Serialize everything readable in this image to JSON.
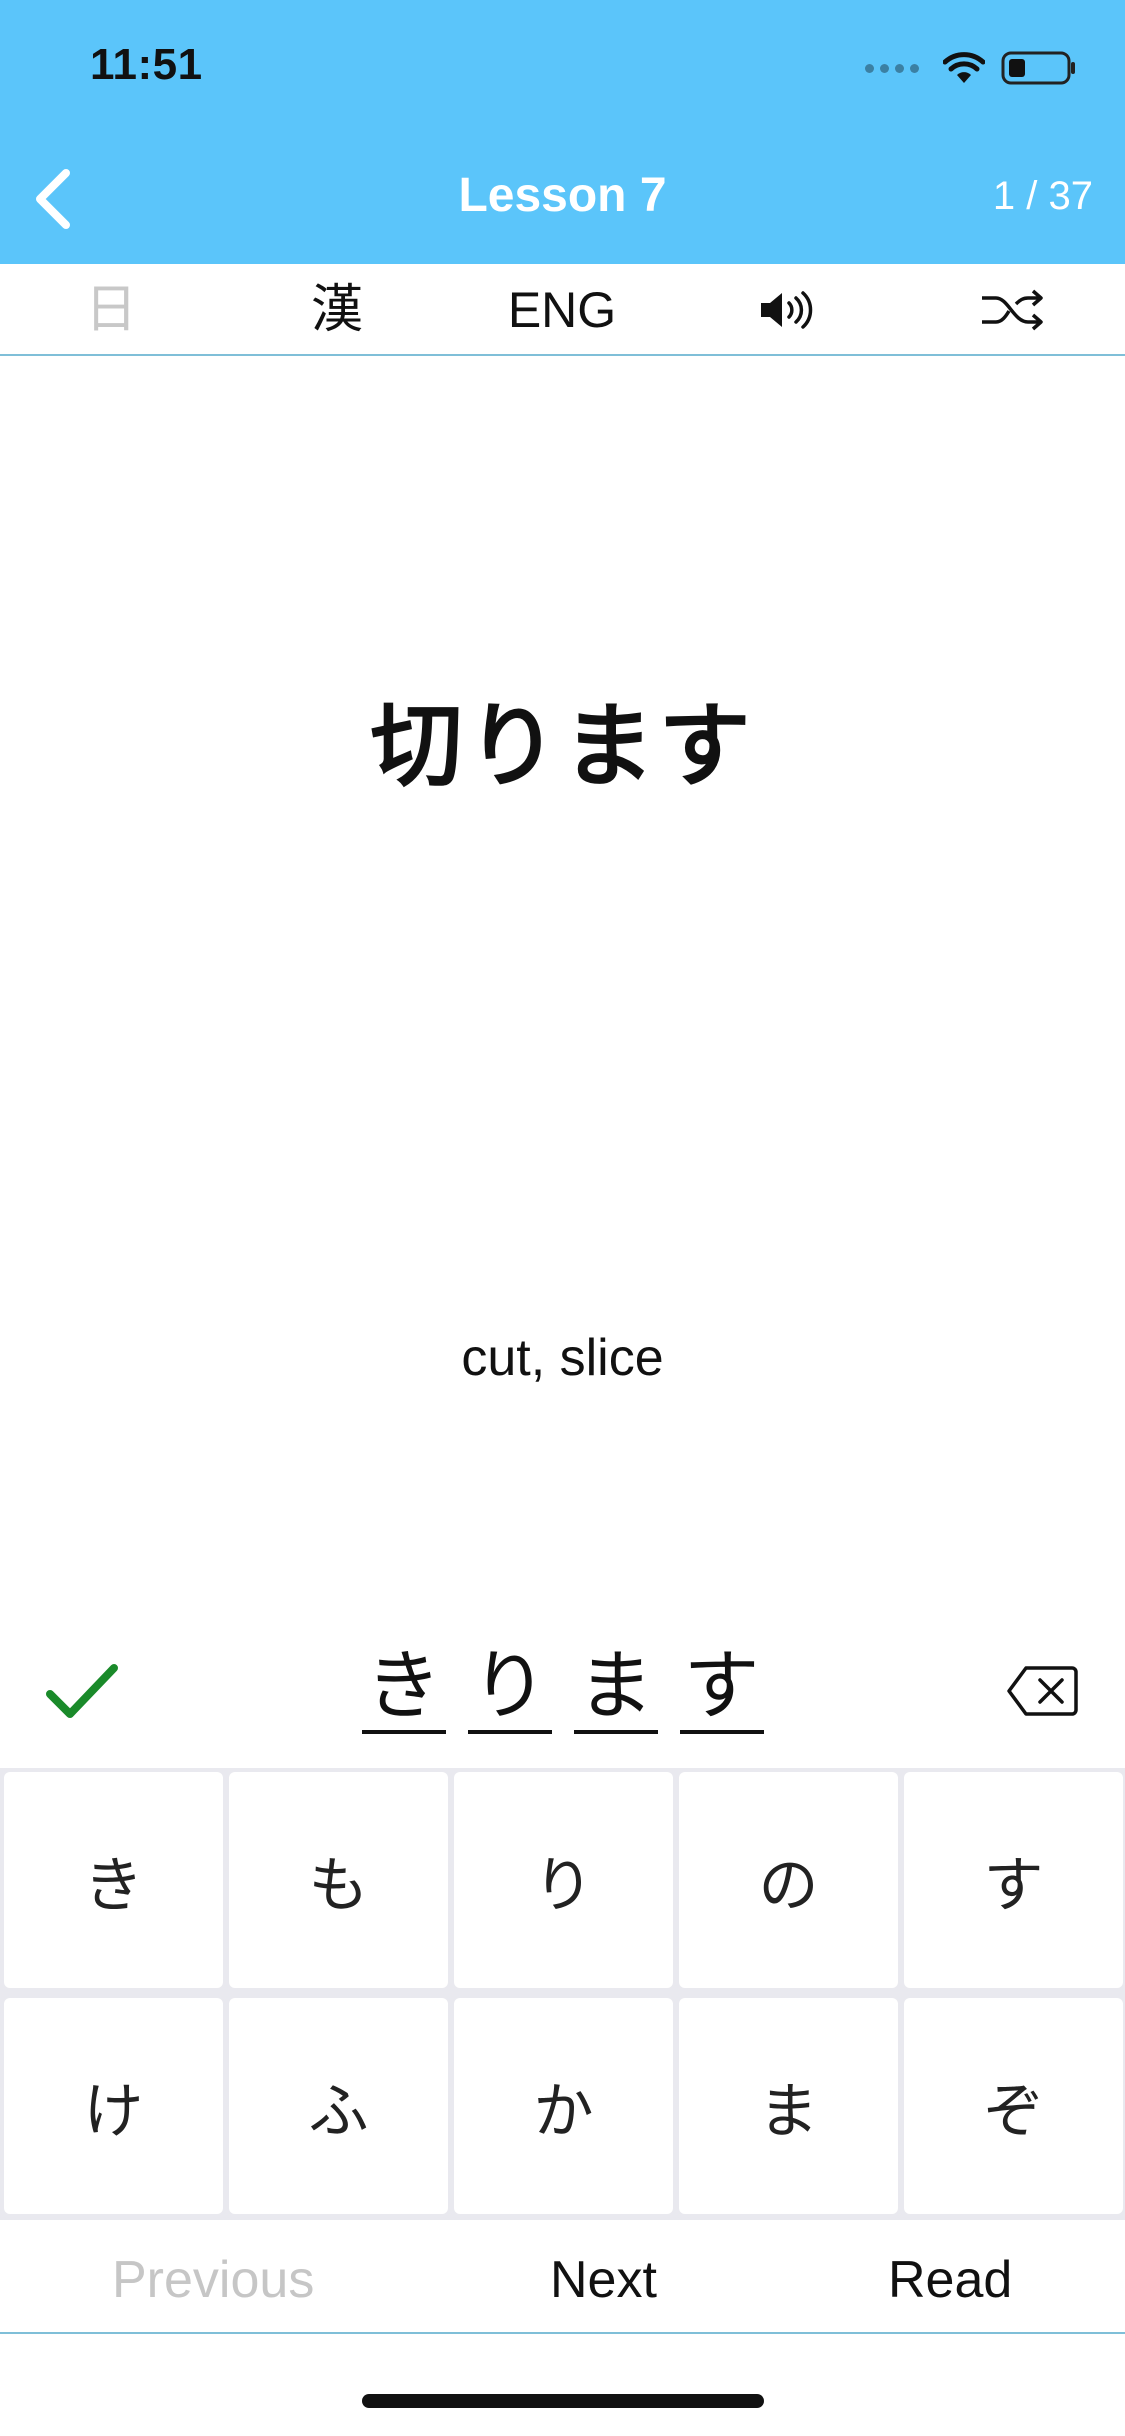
{
  "status_bar": {
    "time": "11:51",
    "icons": [
      "signal-dots-icon",
      "wifi-icon",
      "battery-icon"
    ]
  },
  "nav": {
    "title": "Lesson 7",
    "progress": "1 / 37",
    "back_icon": "chevron-left-icon"
  },
  "toolbar": {
    "day_label": "日",
    "kanji_label": "漢",
    "eng_label": "ENG",
    "sound_icon": "speaker-icon",
    "shuffle_icon": "shuffle-icon"
  },
  "card": {
    "word": "切ります",
    "meaning": "cut, slice"
  },
  "answer": {
    "chars": [
      "き",
      "り",
      "ま",
      "す"
    ],
    "status_icon": "checkmark-icon",
    "backspace_icon": "backspace-icon"
  },
  "keyboard": {
    "rows": [
      [
        "き",
        "も",
        "り",
        "の",
        "す"
      ],
      [
        "け",
        "ふ",
        "か",
        "ま",
        "ぞ"
      ]
    ]
  },
  "bottom_nav": {
    "previous": "Previous",
    "next": "Next",
    "read": "Read"
  },
  "colors": {
    "header": "#5bc5fa",
    "check": "#1a8a2a",
    "disabled": "#c6c6c6"
  }
}
